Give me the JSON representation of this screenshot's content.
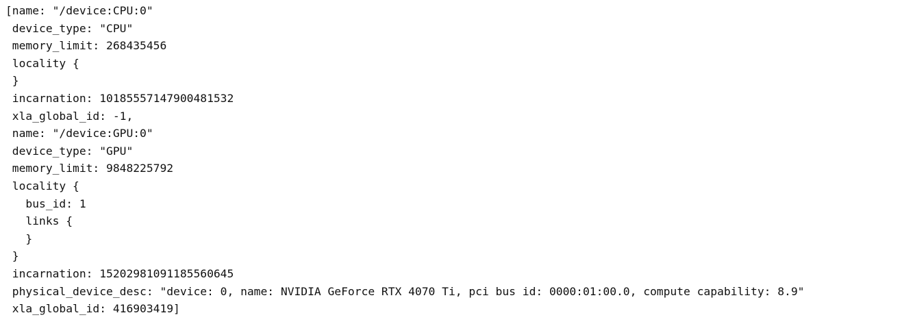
{
  "output": {
    "lines": [
      "[name: \"/device:CPU:0\"",
      " device_type: \"CPU\"",
      " memory_limit: 268435456",
      " locality {",
      " }",
      " incarnation: 10185557147900481532",
      " xla_global_id: -1,",
      " name: \"/device:GPU:0\"",
      " device_type: \"GPU\"",
      " memory_limit: 9848225792",
      " locality {",
      "   bus_id: 1",
      "   links {",
      "   }",
      " }",
      " incarnation: 15202981091185560645",
      " physical_device_desc: \"device: 0, name: NVIDIA GeForce RTX 4070 Ti, pci bus id: 0000:01:00.0, compute capability: 8.9\"",
      " xla_global_id: 416903419]"
    ]
  }
}
